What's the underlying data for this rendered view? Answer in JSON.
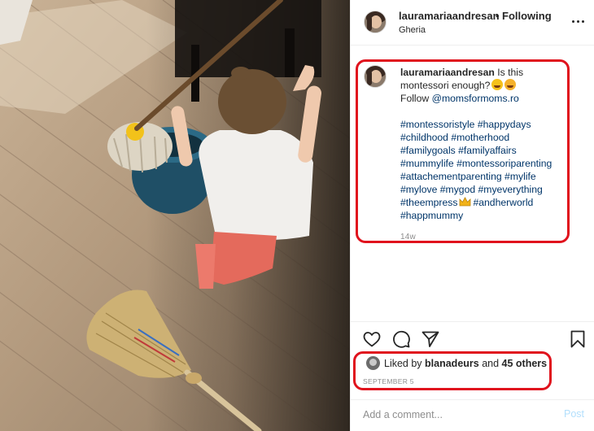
{
  "post": {
    "username": "lauramariaandresan",
    "follow_separator": "•",
    "follow_status": "Following",
    "location": "Gheria",
    "more_icon": "more-options-icon"
  },
  "caption": {
    "username": "lauramariaandresan",
    "text_1": " Is this",
    "text_2": "montessori enough?",
    "follow_prefix": "Follow ",
    "mention": "@momsformoms.ro",
    "hashtag_lines": [
      "#montessoristyle #happydays",
      "#childhood #motherhood",
      "#familygoals #familyaffairs",
      "#mummylife #montessoriparenting",
      "#attachementparenting #mylife",
      "#mylove #mygod #myeverything"
    ],
    "empress_tag": "#theempress",
    "andherworld_tag": "#andherworld",
    "last_tag": "#happmummy",
    "time_ago": "14w",
    "emojis": [
      "grinning-face",
      "face-blowing-kiss",
      "crown"
    ]
  },
  "actions": {
    "icons": [
      "heart-icon",
      "comment-icon",
      "share-icon",
      "bookmark-icon"
    ]
  },
  "likes": {
    "prefix": "Liked by ",
    "user": "blanadeurs",
    "middle": " and ",
    "others": "45 others",
    "date": "SEPTEMBER 5"
  },
  "comment": {
    "placeholder": "Add a comment...",
    "post_label": "Post"
  },
  "colors": {
    "highlight_border": "#e0121d",
    "hashtag": "#003569",
    "muted": "#8e8e8e",
    "post_button_disabled": "#b2dffc"
  }
}
